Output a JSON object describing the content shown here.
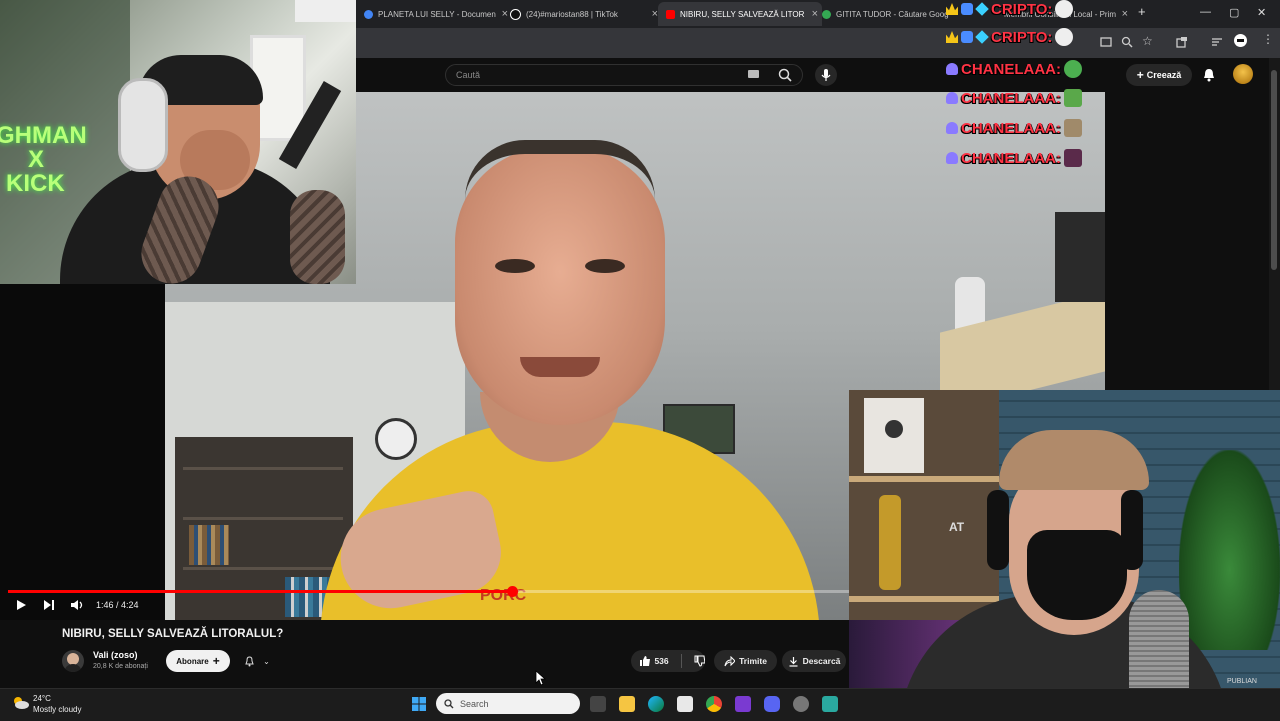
{
  "browser": {
    "tabs": [
      {
        "label": "PLANETA LUI SELLY - Documen",
        "active": false,
        "color": "#4285f4"
      },
      {
        "label": "(24)#mariostan88 | TikTok",
        "active": false,
        "color": "#111111"
      },
      {
        "label": "NIBIRU, SELLY SALVEAZĂ LITOR",
        "active": true,
        "color": "#ff0000"
      },
      {
        "label": "GITITA TUDOR - Căutare Goog",
        "active": false,
        "color": "#34a853"
      },
      {
        "label": "Membrii Consiliului Local - Prim",
        "active": false,
        "color": "#9aa0a6"
      }
    ],
    "new_tab": "+"
  },
  "youtube": {
    "search_placeholder": "Caută",
    "create_label": "Creează",
    "video": {
      "title": "NIBIRU, SELLY SALVEAZĂ LITORALUL?",
      "time_current": "1:46",
      "time_total": "4:24",
      "progress": 0.4,
      "shirt_text": "PORC"
    },
    "channel": {
      "name": "Vali (zoso)",
      "subscribers": "20,8 K de abonați",
      "subscribe_label": "Abonare"
    },
    "actions": {
      "likes": "536",
      "share": "Trimite",
      "download": "Descarcă"
    }
  },
  "chat": [
    {
      "user": "CRIPTO:",
      "badges": [
        "crown-icon",
        "bot-icon",
        "diamond-icon"
      ]
    },
    {
      "user": "CRIPTO:",
      "badges": [
        "crown-icon",
        "bot-icon",
        "diamond-icon"
      ]
    },
    {
      "user": "CHANELAAA:",
      "badges": [
        "shark-icon"
      ]
    },
    {
      "user": "CHANELAAA:",
      "badges": [
        "shark-icon"
      ]
    },
    {
      "user": "CHANELAAA:",
      "badges": [
        "shark-icon"
      ]
    },
    {
      "user": "CHANELAAA:",
      "badges": [
        "shark-icon"
      ]
    }
  ],
  "overlay": {
    "cam_text_top": "GHMAN",
    "cam_text_mid": "X",
    "cam_text_bottom": "KICK",
    "cam2_watermark": "PUBLIAN",
    "cam2_poster": "AT"
  },
  "taskbar": {
    "temperature": "24°C",
    "weather": "Mostly cloudy",
    "search_placeholder": "Search"
  }
}
